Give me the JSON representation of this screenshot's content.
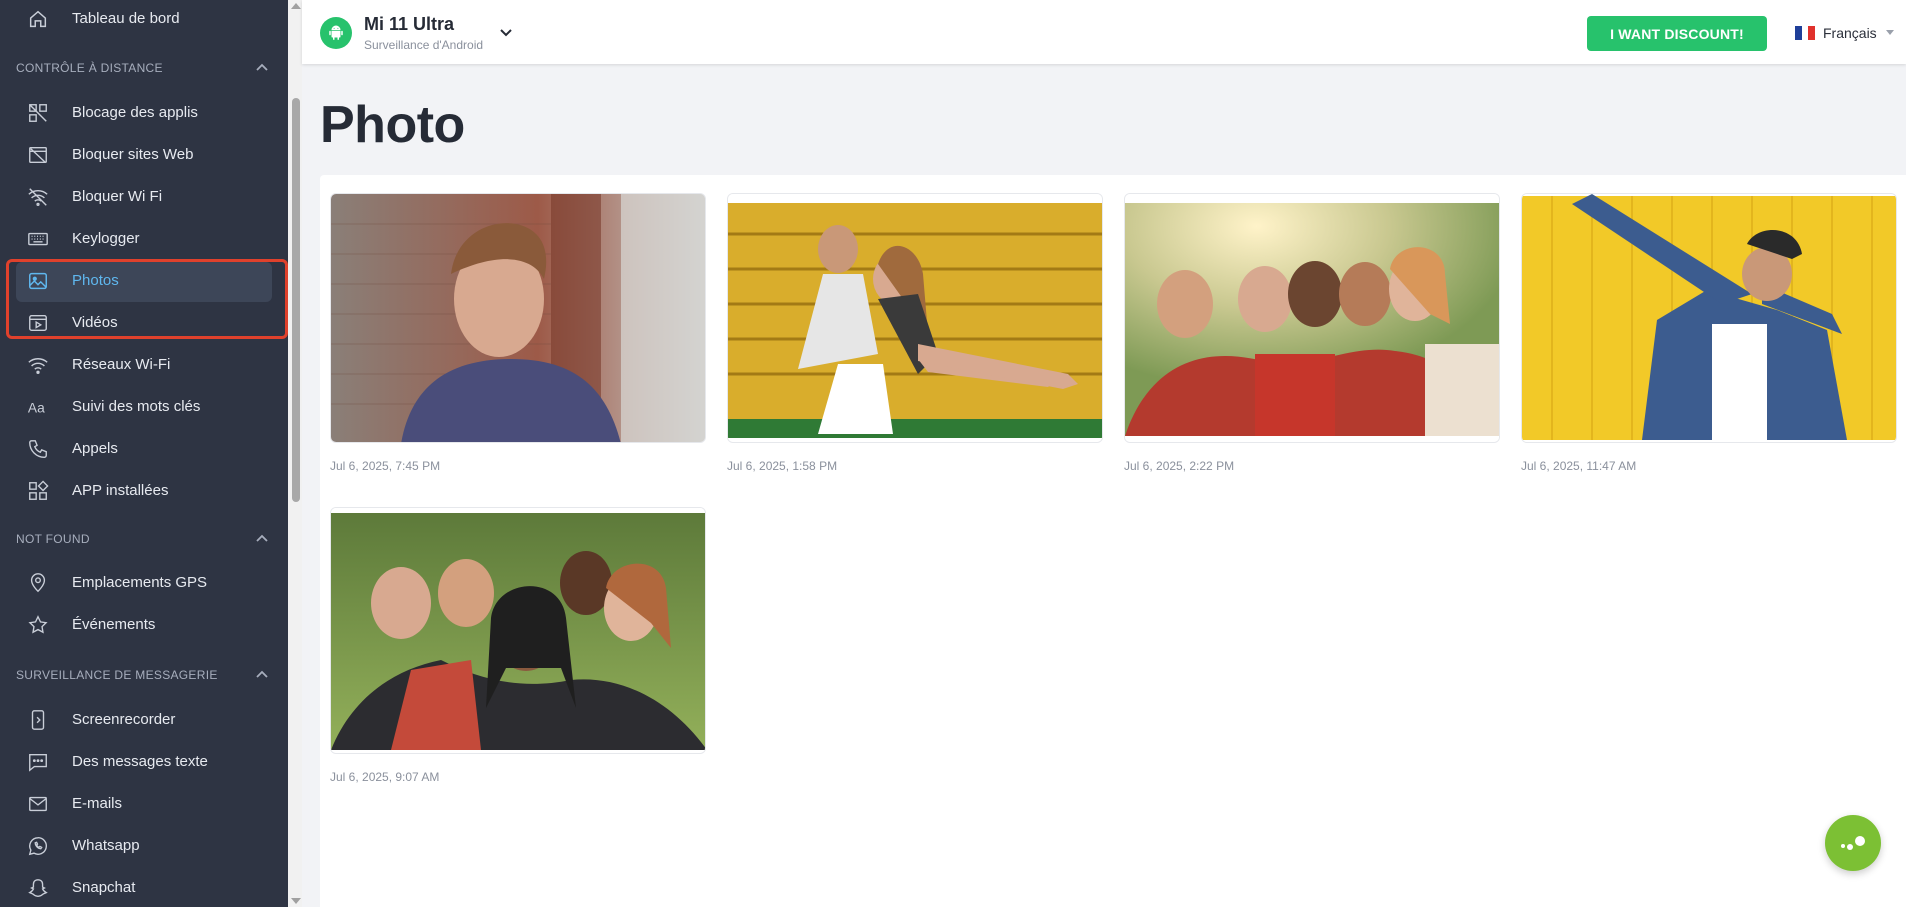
{
  "sidebar": {
    "top_item": {
      "label": "Tableau de bord",
      "icon": "home-icon"
    },
    "sections": [
      {
        "title": "CONTRÔLE À DISTANCE"
      },
      {
        "title": "NOT FOUND"
      },
      {
        "title": "SURVEILLANCE DE MESSAGERIE"
      }
    ],
    "items": [
      {
        "label": "Blocage des applis",
        "icon": "app-block-icon"
      },
      {
        "label": "Bloquer sites Web",
        "icon": "web-block-icon"
      },
      {
        "label": "Bloquer Wi Fi",
        "icon": "wifi-off-icon"
      },
      {
        "label": "Keylogger",
        "icon": "keyboard-icon"
      },
      {
        "label": "Photos",
        "icon": "image-icon",
        "active": true
      },
      {
        "label": "Vidéos",
        "icon": "video-icon"
      },
      {
        "label": "Réseaux Wi-Fi",
        "icon": "wifi-icon"
      },
      {
        "label": "Suivi des mots clés",
        "icon": "text-aa-icon"
      },
      {
        "label": "Appels",
        "icon": "phone-icon"
      },
      {
        "label": "APP installées",
        "icon": "apps-grid-icon"
      },
      {
        "label": "Emplacements GPS",
        "icon": "location-pin-icon"
      },
      {
        "label": "Événements",
        "icon": "star-icon"
      },
      {
        "label": "Screenrecorder",
        "icon": "screen-record-icon"
      },
      {
        "label": "Des messages texte",
        "icon": "message-icon"
      },
      {
        "label": "E-mails",
        "icon": "mail-icon"
      },
      {
        "label": "Whatsapp",
        "icon": "whatsapp-icon"
      },
      {
        "label": "Snapchat",
        "icon": "snapchat-icon"
      }
    ]
  },
  "header": {
    "device_name": "Mi 11 Ultra",
    "device_subtitle": "Surveillance d'Android",
    "discount_button": "I WANT DISCOUNT!",
    "language": "Français",
    "colors": {
      "accent": "#27c26c",
      "sidebar_bg": "#2e3443",
      "active_text": "#5fb7ee",
      "highlight": "#e0412c"
    }
  },
  "main": {
    "title": "Photo",
    "photos": [
      {
        "timestamp": "Jul 6, 2025, 7:45 PM"
      },
      {
        "timestamp": "Jul 6, 2025, 1:58 PM"
      },
      {
        "timestamp": "Jul 6, 2025, 2:22 PM"
      },
      {
        "timestamp": "Jul 6, 2025, 11:47 AM"
      },
      {
        "timestamp": "Jul 6, 2025, 9:07 AM"
      }
    ]
  }
}
